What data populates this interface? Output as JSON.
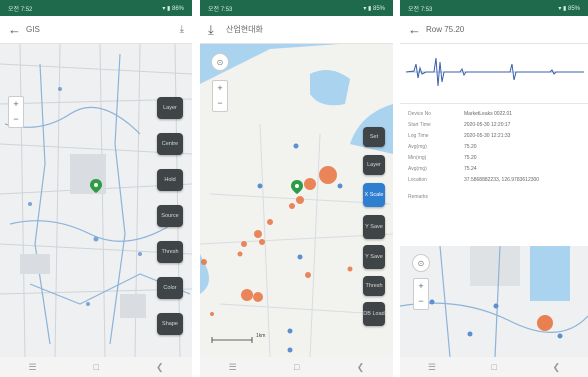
{
  "screens": [
    {
      "status_left": "오전 7:52",
      "status_right": "▾ ▮ 86%",
      "title": "GIS",
      "buttons": [
        "Layer",
        "Centre",
        "Hold",
        "Source",
        "Thresh",
        "Color",
        "Shape"
      ]
    },
    {
      "status_left": "오전 7:53",
      "status_right": "▾ ▮ 85%",
      "title": "산업현대화",
      "buttons": [
        {
          "label": "Set",
          "active": false
        },
        {
          "label": "Layer",
          "active": false
        },
        {
          "label": "X Scale",
          "active": true
        },
        {
          "label": "Y Save",
          "active": false
        },
        {
          "label": "Y Save",
          "active": false
        },
        {
          "label": "Thresh",
          "active": false
        },
        {
          "label": "DB Load",
          "active": false
        }
      ],
      "scale_label": "1km"
    },
    {
      "status_left": "오전 7:53",
      "status_right": "▾ ▮ 85%",
      "title": "Row 75.20",
      "fields": [
        {
          "key": "Device No",
          "value": "MarketLeaks 0022.01"
        },
        {
          "key": "Start Time",
          "value": "2020-05-30 12:20:17"
        },
        {
          "key": "Log Time",
          "value": "2020-05-30 12:21:33"
        },
        {
          "key": "Avg(mg)",
          "value": "75.20"
        },
        {
          "key": "Min(mg)",
          "value": "75.20"
        },
        {
          "key": "Avg(mg)",
          "value": "75.24"
        },
        {
          "key": "Location",
          "value": "37.5868882233, 126.9783612300"
        },
        {
          "key": "",
          "value": ""
        }
      ],
      "remarks_label": "Remarks"
    }
  ],
  "nav_icons": [
    "menu-icon",
    "home-icon",
    "back-icon"
  ]
}
